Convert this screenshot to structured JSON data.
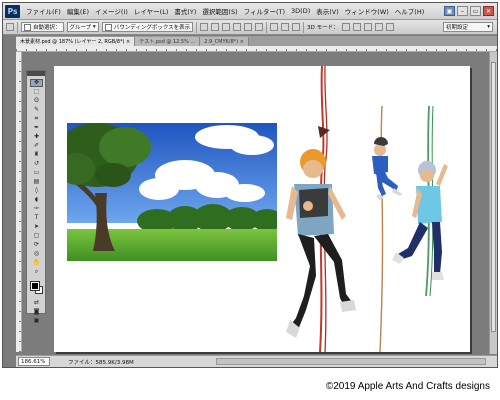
{
  "menubar": {
    "logo": "Ps",
    "items": [
      "ファイル(F)",
      "編集(E)",
      "イメージ(I)",
      "レイヤー(L)",
      "書式(Y)",
      "選択範囲(S)",
      "フィルター(T)",
      "3D(D)",
      "表示(V)",
      "ウィンドウ(W)",
      "ヘルプ(H)"
    ],
    "window_controls": [
      "▣",
      "–",
      "▭",
      "✕"
    ]
  },
  "options": {
    "auto_select_label": "自動選択：",
    "auto_select_value": "グループ",
    "bounding_box_label": "バウンディングボックスを表示",
    "mode_3d_label": "3D モード：",
    "workspace": "初期設定"
  },
  "tabs": [
    {
      "label": "木景素材.psd @ 187% (レイヤー 2, RGB/8*) ×",
      "active": true
    },
    {
      "label": "テスト.psd @ 12.5% ...",
      "active": false
    },
    {
      "label": "2.9_CMYK/8*) ×",
      "active": false
    }
  ],
  "tools": [
    {
      "icon": "move-tool",
      "glyph": "✥"
    },
    {
      "icon": "marquee-tool",
      "glyph": "⬚"
    },
    {
      "icon": "lasso-tool",
      "glyph": "ʘ"
    },
    {
      "icon": "quick-select-tool",
      "glyph": "✎"
    },
    {
      "icon": "crop-tool",
      "glyph": "⌗"
    },
    {
      "icon": "eyedropper-tool",
      "glyph": "✒"
    },
    {
      "icon": "healing-tool",
      "glyph": "✚"
    },
    {
      "icon": "brush-tool",
      "glyph": "✐"
    },
    {
      "icon": "stamp-tool",
      "glyph": "♜"
    },
    {
      "icon": "history-brush-tool",
      "glyph": "↺"
    },
    {
      "icon": "eraser-tool",
      "glyph": "▭"
    },
    {
      "icon": "gradient-tool",
      "glyph": "▤"
    },
    {
      "icon": "blur-tool",
      "glyph": "◊"
    },
    {
      "icon": "dodge-tool",
      "glyph": "◖"
    },
    {
      "icon": "pen-tool",
      "glyph": "✑"
    },
    {
      "icon": "type-tool",
      "glyph": "T"
    },
    {
      "icon": "path-select-tool",
      "glyph": "➤"
    },
    {
      "icon": "shape-tool",
      "glyph": "▢"
    },
    {
      "icon": "3d-rotate-tool",
      "glyph": "⟳"
    },
    {
      "icon": "3d-camera-tool",
      "glyph": "◎"
    },
    {
      "icon": "hand-tool",
      "glyph": "✋"
    },
    {
      "icon": "zoom-tool",
      "glyph": "⌕"
    }
  ],
  "bottom_tools": [
    {
      "icon": "swap-colors-icon",
      "glyph": "⇄"
    },
    {
      "icon": "quick-mask-icon",
      "glyph": "◙"
    },
    {
      "icon": "screen-mode-icon",
      "glyph": "▣"
    }
  ],
  "status": {
    "zoom": "186.61%",
    "info": "ファイル：585.9K/3.98M"
  },
  "copyright": "©2019 Apple Arts And Crafts designs",
  "colors": {
    "app_bg": "#7c7c7c",
    "canvas": "#ffffff",
    "sky": "#3f79d6",
    "grass": "#5cab2f",
    "helmet": "#e89a2a",
    "rope_red": "#c0392b",
    "rope_green": "#4a9a62"
  }
}
